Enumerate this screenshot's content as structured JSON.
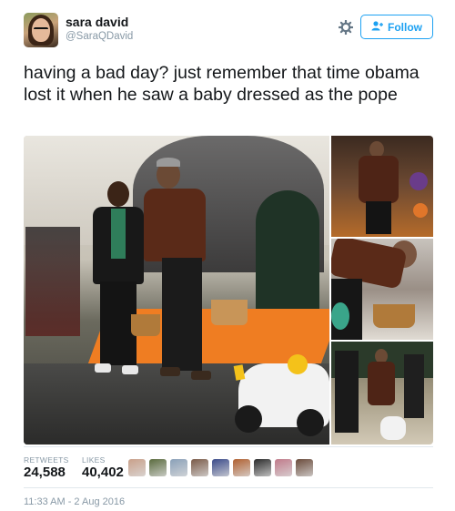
{
  "user": {
    "display_name": "sara david",
    "handle": "@SaraQDavid",
    "avatar_icon": "profile-avatar"
  },
  "actions": {
    "gear_icon": "gear-icon",
    "follow_label": "Follow",
    "follow_icon": "add-person-icon",
    "accent_color": "#1da1f2"
  },
  "tweet": {
    "text": "having a bad day? just remember that time obama lost it when he saw a baby dressed as the pope"
  },
  "media": {
    "count": 4
  },
  "stats": {
    "retweets_label": "RETWEETS",
    "retweets_value": "24,588",
    "likes_label": "LIKES",
    "likes_value": "40,402"
  },
  "likers": [
    "#c9a08a",
    "#5a6b3e",
    "#8aa0b8",
    "#7a5a48",
    "#3a4a8a",
    "#b06030",
    "#2a2a2a",
    "#c07a8a",
    "#6a4a3a"
  ],
  "timestamp": "11:33 AM - 2 Aug 2016"
}
